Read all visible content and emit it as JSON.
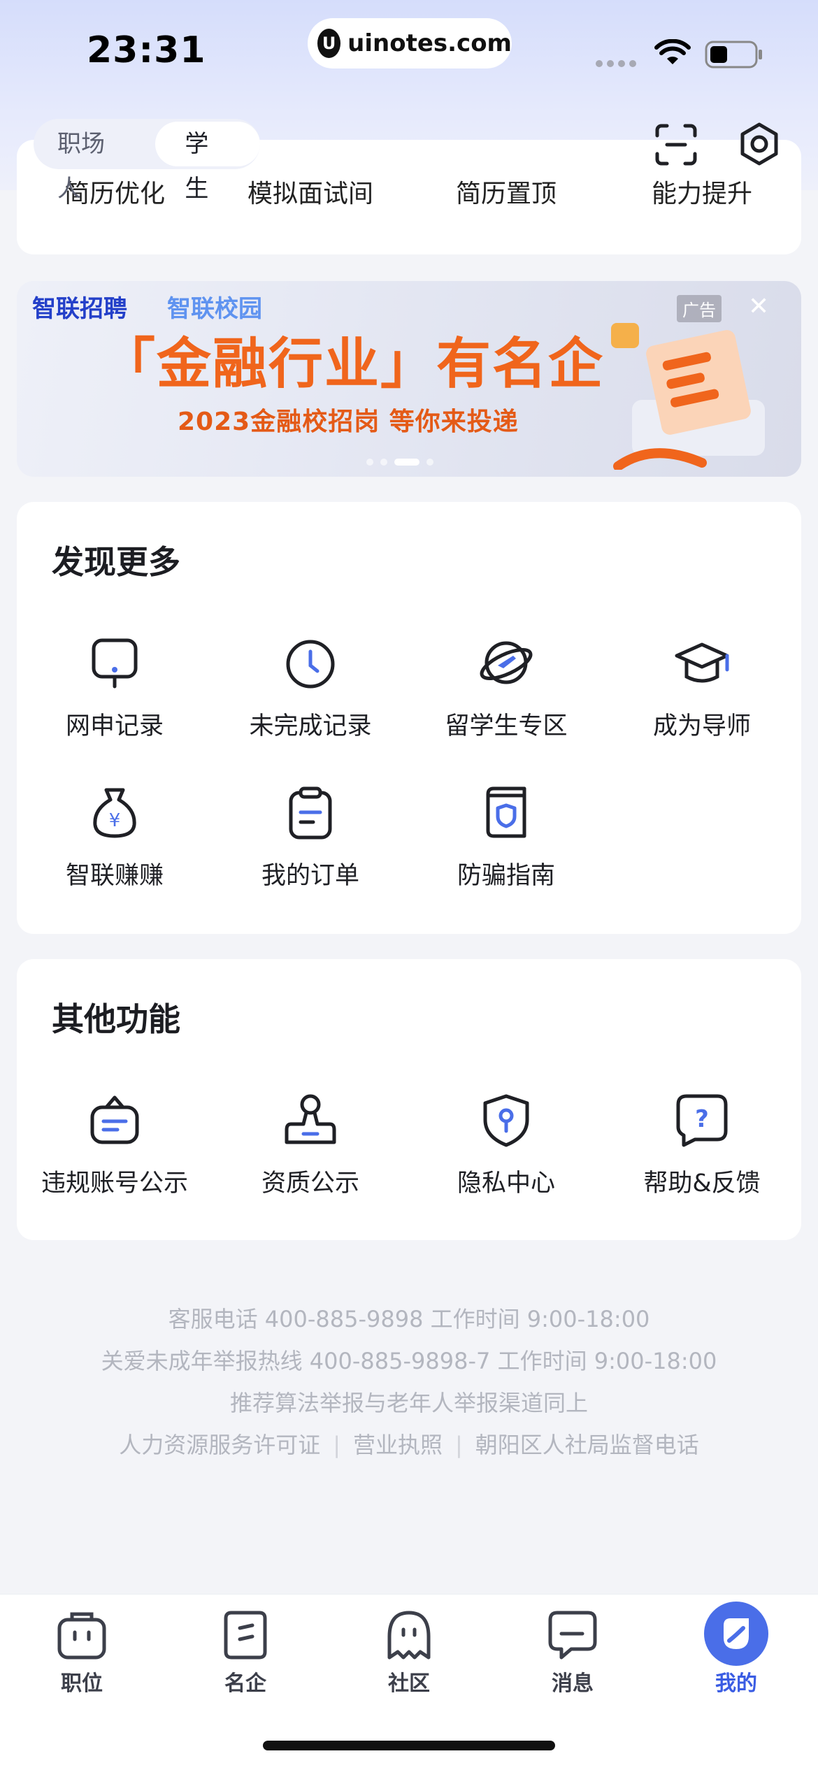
{
  "status_bar": {
    "time": "23:31",
    "url": "uinotes.com"
  },
  "header": {
    "roles": [
      "职场人",
      "学生"
    ],
    "active_role": "学生",
    "icons": [
      "scan-icon",
      "settings-icon"
    ]
  },
  "tools": {
    "labels": [
      "简历优化",
      "模拟面试间",
      "简历置顶",
      "能力提升"
    ]
  },
  "banner": {
    "brand_primary": "智联招聘",
    "brand_secondary": "智联校园",
    "headline": "「金融行业」有名企",
    "subline": "2023金融校招岗  等你来投递",
    "ad_label": "广告",
    "close": "✕"
  },
  "discover": {
    "title": "发现更多",
    "items": [
      {
        "label": "网申记录",
        "icon": "monitor-icon"
      },
      {
        "label": "未完成记录",
        "icon": "clock-icon"
      },
      {
        "label": "留学生专区",
        "icon": "planet-plane-icon"
      },
      {
        "label": "成为导师",
        "icon": "graduation-cap-icon"
      },
      {
        "label": "智联赚赚",
        "icon": "money-bag-icon"
      },
      {
        "label": "我的订单",
        "icon": "clipboard-icon"
      },
      {
        "label": "防骗指南",
        "icon": "shield-book-icon"
      }
    ]
  },
  "other": {
    "title": "其他功能",
    "items": [
      {
        "label": "违规账号公示",
        "icon": "notice-bag-icon"
      },
      {
        "label": "资质公示",
        "icon": "stamp-icon"
      },
      {
        "label": "隐私中心",
        "icon": "privacy-shield-icon"
      },
      {
        "label": "帮助&反馈",
        "icon": "help-question-icon"
      }
    ]
  },
  "footer": {
    "line1": "客服电话 400-885-9898  工作时间 9:00-18:00",
    "line2": "关爱未成年举报热线 400-885-9898-7  工作时间 9:00-18:00",
    "line3": "推荐算法举报与老年人举报渠道同上",
    "links": [
      "人力资源服务许可证",
      "营业执照",
      "朝阳区人社局监督电话"
    ],
    "separator": "|"
  },
  "tabbar": {
    "items": [
      {
        "label": "职位",
        "icon": "briefcase-icon"
      },
      {
        "label": "名企",
        "icon": "company-icon"
      },
      {
        "label": "社区",
        "icon": "community-ghost-icon"
      },
      {
        "label": "消息",
        "icon": "message-icon"
      },
      {
        "label": "我的",
        "icon": "profile-icon"
      }
    ],
    "active": "我的"
  },
  "colors": {
    "accent": "#3a5ce3",
    "icon_stroke": "#1f2025",
    "icon_accent": "#4a6ee8"
  }
}
